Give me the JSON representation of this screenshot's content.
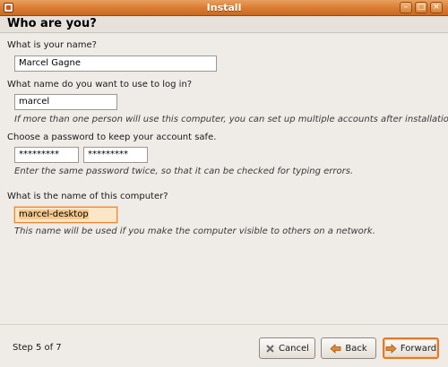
{
  "window": {
    "title": "Install"
  },
  "page": {
    "title": "Who are you?"
  },
  "name": {
    "label": "What is your name?",
    "value": "Marcel Gagne"
  },
  "login": {
    "label": "What name do you want to use to log in?",
    "value": "marcel",
    "hint": "If more than one person will use this computer, you can set up multiple accounts after installation."
  },
  "password": {
    "label": "Choose a password to keep your account safe.",
    "value": "*********",
    "confirm_value": "*********",
    "hint": "Enter the same password twice, so that it can be checked for typing errors."
  },
  "computer": {
    "label": "What is the name of this computer?",
    "value": "marcel-desktop",
    "hint": "This name will be used if you make the computer visible to others on a network."
  },
  "footer": {
    "step": "Step 5 of 7",
    "cancel_label": "Cancel",
    "back_label": "Back",
    "forward_label": "Forward"
  },
  "icons": {
    "cancel": "cancel-x-icon",
    "back": "arrow-left-icon",
    "forward": "arrow-right-icon"
  },
  "colors": {
    "titlebar": "#d97a30",
    "focus": "#e78a38",
    "accent": "#e07b2a"
  }
}
